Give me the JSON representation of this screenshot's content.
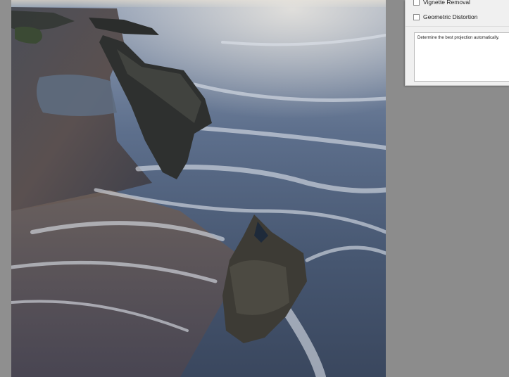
{
  "dialog": {
    "options": [
      {
        "label": "Vignette Removal",
        "checked": false
      },
      {
        "label": "Geometric Distortion",
        "checked": false
      }
    ],
    "description": "Determine the best projection automatically."
  },
  "image": {
    "subject": "shipwreck-on-beach-long-exposure"
  }
}
